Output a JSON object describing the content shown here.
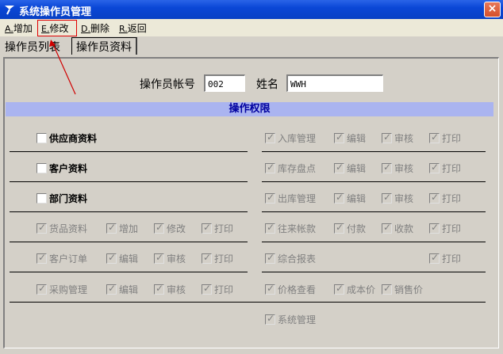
{
  "window": {
    "title": "系统操作员管理",
    "close_glyph": "×"
  },
  "menu": [
    {
      "key": "A.",
      "label": "增加"
    },
    {
      "key": "E.",
      "label": "修改"
    },
    {
      "key": "D.",
      "label": "删除"
    },
    {
      "key": "R.",
      "label": "返回"
    }
  ],
  "tabs": {
    "list": "操作员列表",
    "info": "操作员资料"
  },
  "form": {
    "account_label": "操作员帐号",
    "account_value": "002",
    "name_label": "姓名",
    "name_value": "WWH"
  },
  "permissions": {
    "header": "操作权限",
    "check_glyph": "✓",
    "left": [
      {
        "label": "供应商资料",
        "checked": false,
        "subs": []
      },
      {
        "label": "客户资料",
        "checked": false,
        "subs": []
      },
      {
        "label": "部门资料",
        "checked": false,
        "subs": []
      },
      {
        "label": "货品资料",
        "checked": true,
        "subs": [
          "增加",
          "修改",
          "打印"
        ]
      },
      {
        "label": "客户订单",
        "checked": true,
        "subs": [
          "编辑",
          "审核",
          "打印"
        ]
      },
      {
        "label": "采购管理",
        "checked": true,
        "subs": [
          "编辑",
          "审核",
          "打印"
        ]
      }
    ],
    "right": [
      {
        "label": "入库管理",
        "checked": true,
        "subs": [
          "编辑",
          "审核",
          "打印"
        ]
      },
      {
        "label": "库存盘点",
        "checked": true,
        "subs": [
          "编辑",
          "审核",
          "打印"
        ]
      },
      {
        "label": "出库管理",
        "checked": true,
        "subs": [
          "编辑",
          "审核",
          "打印"
        ]
      },
      {
        "label": "往来帐款",
        "checked": true,
        "subs": [
          "付款",
          "收款",
          "打印"
        ]
      },
      {
        "label": "综合报表",
        "checked": true,
        "subs": [
          "",
          "",
          "打印"
        ]
      },
      {
        "label": "价格查看",
        "checked": true,
        "subs": [
          "成本价",
          "销售价"
        ]
      },
      {
        "label": "系统管理",
        "checked": true,
        "subs": []
      }
    ]
  }
}
